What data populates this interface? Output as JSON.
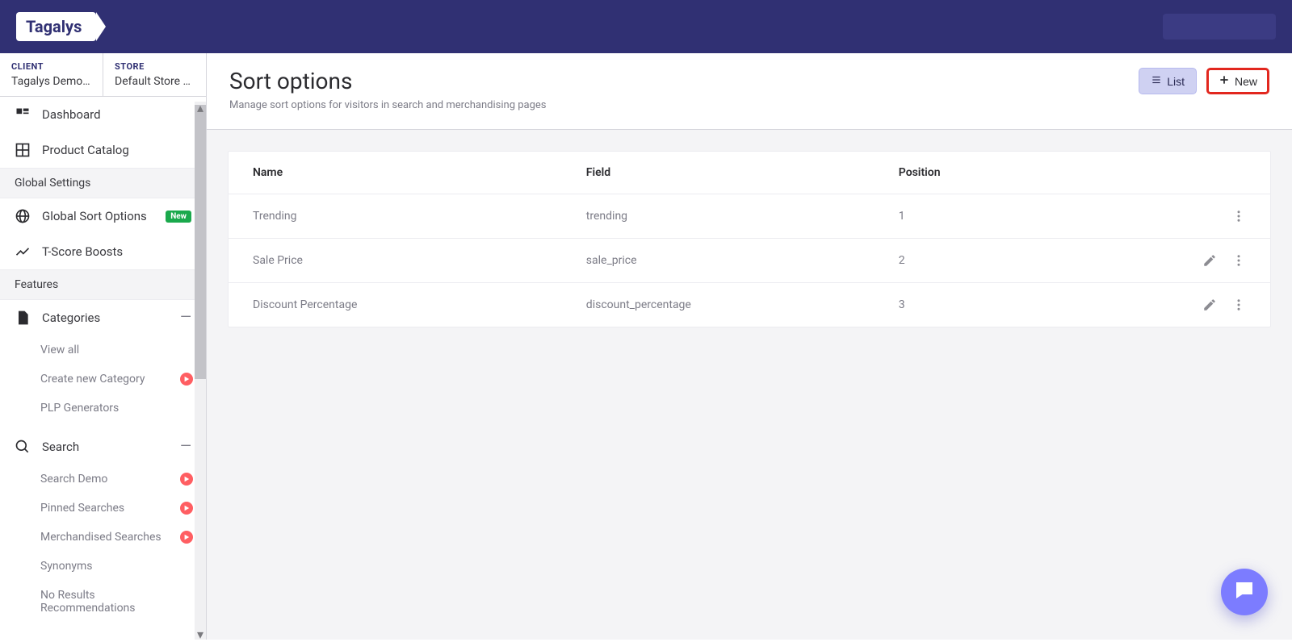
{
  "brand": "Tagalys",
  "context": {
    "client_label": "CLIENT",
    "client_value": "Tagalys Demo …",
    "store_label": "STORE",
    "store_value": "Default Store …"
  },
  "sidebar": {
    "items": [
      {
        "label": "Dashboard"
      },
      {
        "label": "Product Catalog"
      }
    ],
    "section_global": "Global Settings",
    "global_items": [
      {
        "label": "Global Sort Options",
        "badge": "New"
      },
      {
        "label": "T-Score Boosts"
      }
    ],
    "section_features": "Features",
    "categories": {
      "label": "Categories",
      "subs": [
        {
          "label": "View all"
        },
        {
          "label": "Create new Category",
          "dot": true
        },
        {
          "label": "PLP Generators"
        }
      ]
    },
    "search": {
      "label": "Search",
      "subs": [
        {
          "label": "Search Demo",
          "dot": true
        },
        {
          "label": "Pinned Searches",
          "dot": true
        },
        {
          "label": "Merchandised Searches",
          "dot": true
        },
        {
          "label": "Synonyms"
        },
        {
          "label": "No Results Recommendations"
        }
      ]
    }
  },
  "page": {
    "title": "Sort options",
    "subtitle": "Manage sort options for visitors in search and merchandising pages",
    "btn_list": "List",
    "btn_new": "New"
  },
  "table": {
    "headers": {
      "name": "Name",
      "field": "Field",
      "position": "Position"
    },
    "rows": [
      {
        "name": "Trending",
        "field": "trending",
        "position": "1",
        "editable": false
      },
      {
        "name": "Sale Price",
        "field": "sale_price",
        "position": "2",
        "editable": true
      },
      {
        "name": "Discount Percentage",
        "field": "discount_percentage",
        "position": "3",
        "editable": true
      }
    ]
  }
}
